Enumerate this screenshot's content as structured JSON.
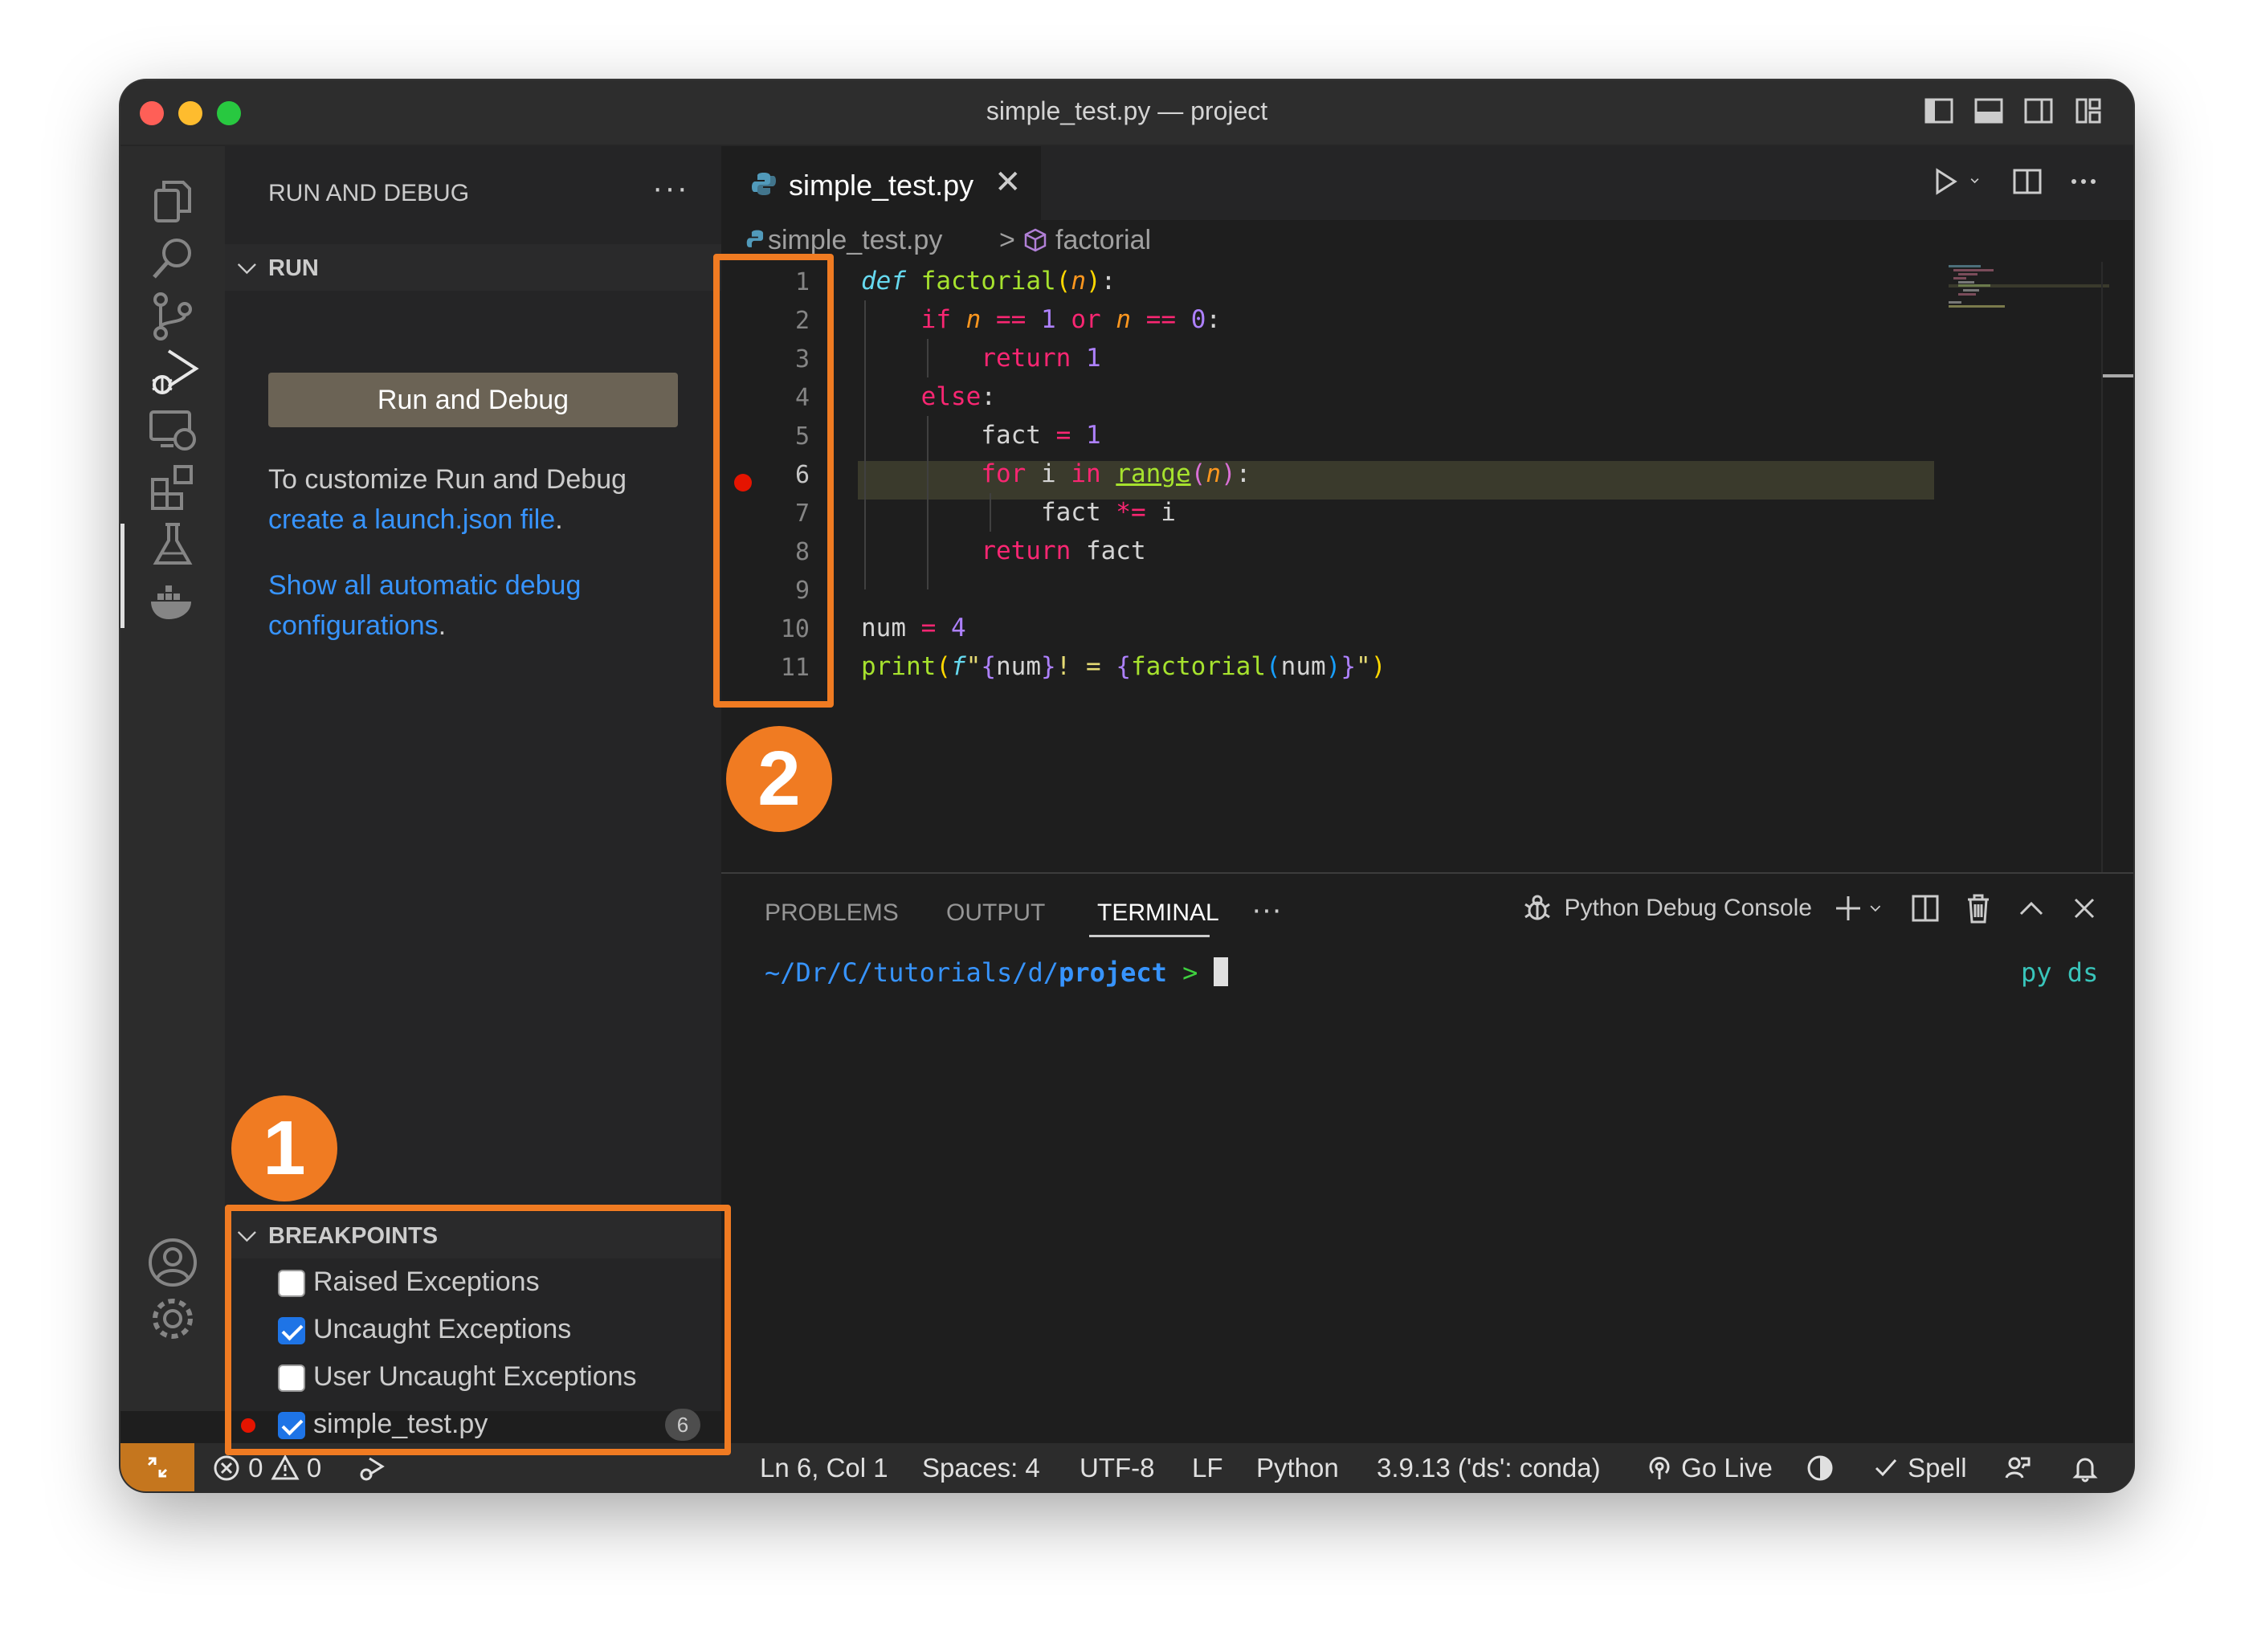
{
  "window": {
    "title": "simple_test.py — project"
  },
  "sidebar": {
    "title": "RUN AND DEBUG",
    "more": "···",
    "run_section": "RUN",
    "run_button": "Run and Debug",
    "customize_text": "To customize Run and Debug",
    "customize_link": "create a launch.json file",
    "customize_tail": ".",
    "show_all_link": "Show all automatic debug configurations",
    "show_all_tail": ".",
    "breakpoints_section": "BREAKPOINTS",
    "breakpoints": [
      {
        "label": "Raised Exceptions",
        "checked": false
      },
      {
        "label": "Uncaught Exceptions",
        "checked": true
      },
      {
        "label": "User Uncaught Exceptions",
        "checked": false
      },
      {
        "label": "simple_test.py",
        "checked": true,
        "line": "6"
      }
    ]
  },
  "editor": {
    "tab_label": "simple_test.py",
    "tab_close": "✕",
    "breadcrumb_file": "simple_test.py",
    "breadcrumb_sep": ">",
    "breadcrumb_symbol": "factorial",
    "line_numbers": [
      "1",
      "2",
      "3",
      "4",
      "5",
      "6",
      "7",
      "8",
      "9",
      "10",
      "11"
    ],
    "current_line": "6",
    "breakpoint_line": "6"
  },
  "annotations": {
    "badge1": "1",
    "badge2": "2"
  },
  "panel": {
    "tabs": [
      "PROBLEMS",
      "OUTPUT",
      "TERMINAL"
    ],
    "active_tab": "TERMINAL",
    "more": "···",
    "console_name": "Python Debug Console",
    "prompt_path": "~/Dr/C/tutorials/d/",
    "prompt_dir": "project",
    "prompt_symbol": ">",
    "env_label": "py ds"
  },
  "statusbar": {
    "errors": "0",
    "warnings": "0",
    "position": "Ln 6, Col 1",
    "spaces": "Spaces: 4",
    "encoding": "UTF-8",
    "eol": "LF",
    "language": "Python",
    "interpreter": "3.9.13 ('ds': conda)",
    "go_live": "Go Live",
    "spell": "Spell"
  },
  "colors": {
    "accent_orange": "#f07b22",
    "breakpoint_red": "#e51400",
    "link_blue": "#3794ff",
    "run_button": "#6b6355",
    "remote_indicator": "#c5761e"
  },
  "icons": [
    "explorer-icon",
    "search-icon",
    "source-control-icon",
    "run-debug-icon",
    "remote-explorer-icon",
    "extensions-icon",
    "testing-icon",
    "docker-icon",
    "account-icon",
    "settings-gear-icon",
    "python-file-icon",
    "run-icon",
    "split-editor-icon",
    "bug-icon",
    "plus-icon",
    "trash-icon",
    "chevron-up-icon",
    "close-icon",
    "terminal-icon",
    "bell-icon"
  ]
}
